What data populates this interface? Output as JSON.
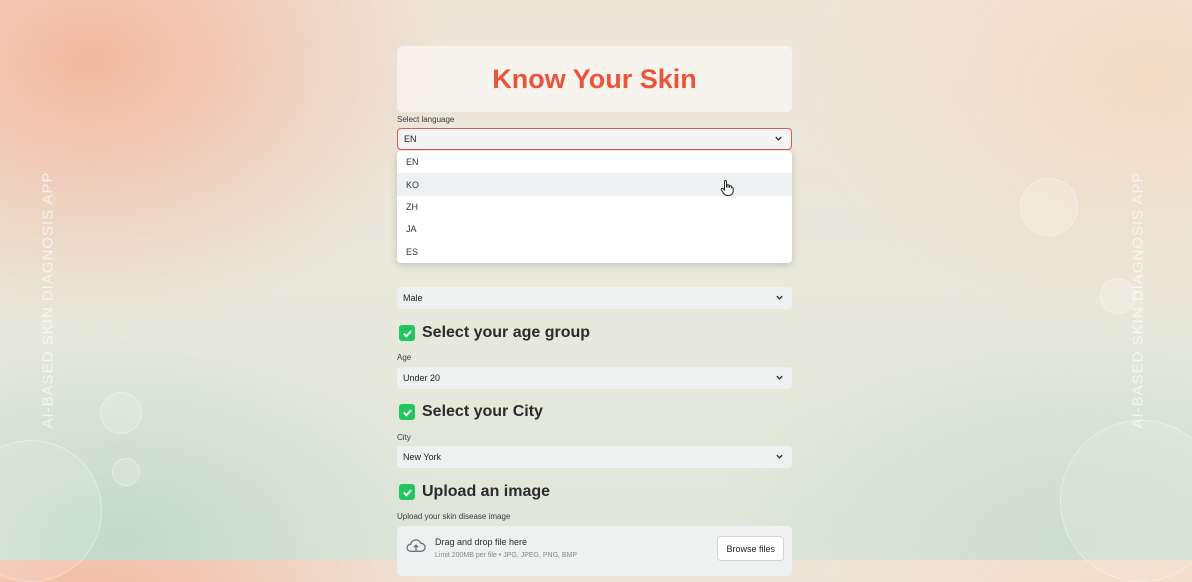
{
  "app": {
    "title": "Know Your Skin",
    "side_text": "AI-BASED SKIN DIAGNOSIS APP"
  },
  "language": {
    "label": "Select language",
    "selected": "EN",
    "options": [
      "EN",
      "KO",
      "ZH",
      "JA",
      "ES"
    ],
    "hovered": "KO"
  },
  "gender": {
    "selected": "Male"
  },
  "age": {
    "section_title": "Select your age group",
    "label": "Age",
    "selected": "Under 20"
  },
  "city": {
    "section_title": "Select your City",
    "label": "City",
    "selected": "New York"
  },
  "upload": {
    "section_title": "Upload an image",
    "label": "Upload your skin disease image",
    "drop_text": "Drag and drop file here",
    "limit_text": "Limit 200MB per file • JPG, JPEG, PNG, BMP",
    "browse_label": "Browse files"
  },
  "colors": {
    "accent": "#e8553a",
    "check": "#22c55e",
    "focus_border": "#e05a5a"
  },
  "icons": [
    "chevron-down-icon",
    "checkbox-checked-icon",
    "cloud-upload-icon",
    "hand-pointer-icon"
  ]
}
